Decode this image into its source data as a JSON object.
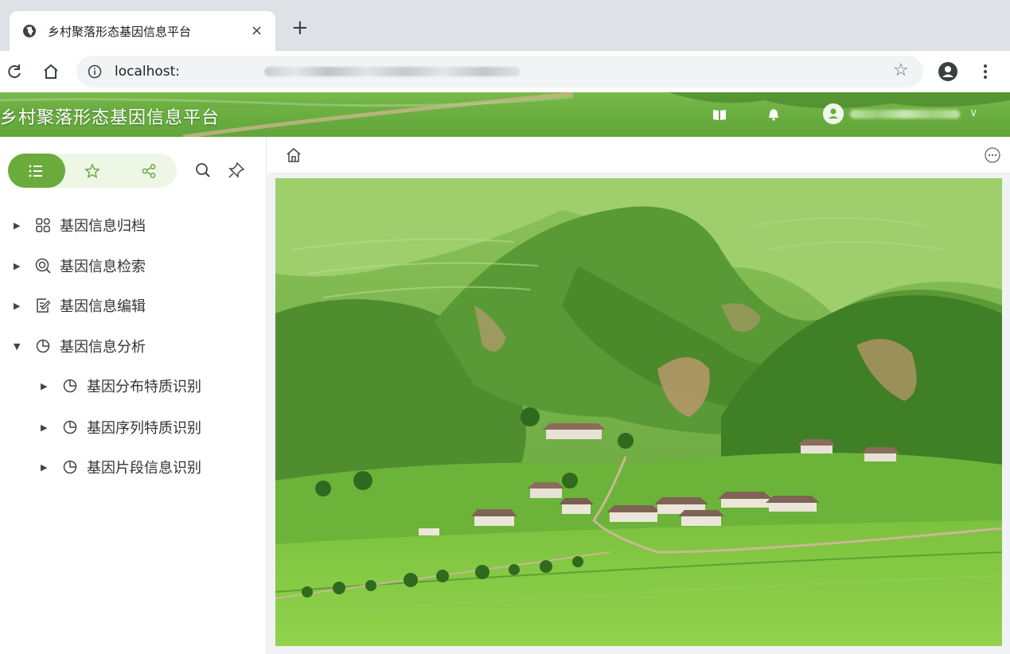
{
  "browser": {
    "tab_title": "乡村聚落形态基因信息平台",
    "tab_close": "×",
    "new_tab": "+",
    "address_host": "localhost:",
    "bookmark_star": "☆"
  },
  "app": {
    "title": "乡村聚落形态基因信息平台",
    "colors": {
      "brand_green": "#6aab3c",
      "seg_bg": "#eef6e6",
      "text": "#333333"
    }
  },
  "sidebar": {
    "segments": [
      {
        "icon": "list-icon",
        "active": true
      },
      {
        "icon": "star-icon",
        "active": false
      },
      {
        "icon": "share-icon",
        "active": false
      }
    ],
    "tools": [
      "search-icon",
      "pin-icon"
    ],
    "menu": [
      {
        "label": "基因信息归档",
        "icon": "apps-icon",
        "expanded": false
      },
      {
        "label": "基因信息检索",
        "icon": "search-circle-icon",
        "expanded": false
      },
      {
        "label": "基因信息编辑",
        "icon": "edit-doc-icon",
        "expanded": false
      },
      {
        "label": "基因信息分析",
        "icon": "pie-chart-icon",
        "expanded": true,
        "children": [
          {
            "label": "基因分布特质识别",
            "icon": "pie-chart-icon"
          },
          {
            "label": "基因序列特质识别",
            "icon": "pie-chart-icon"
          },
          {
            "label": "基因片段信息识别",
            "icon": "pie-chart-icon"
          }
        ]
      }
    ]
  }
}
